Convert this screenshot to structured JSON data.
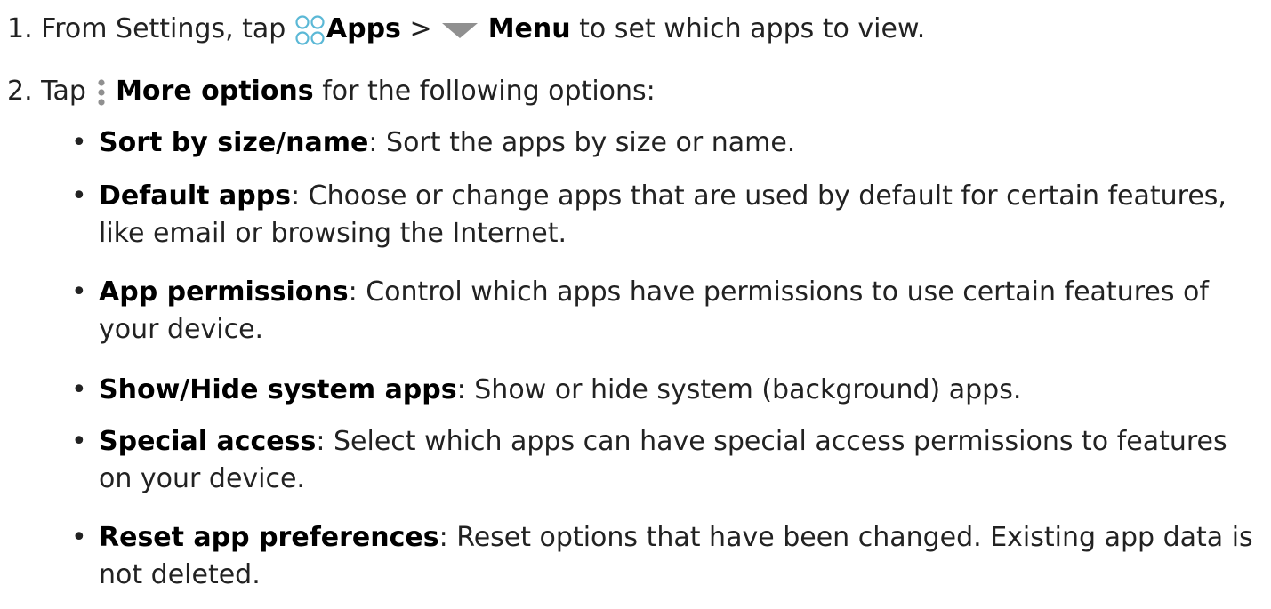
{
  "steps": [
    {
      "number": "1.",
      "text_before": "From Settings, tap",
      "apps_label": "Apps",
      "separator": ">",
      "menu_label": "Menu",
      "text_after": "to set which apps to view."
    },
    {
      "number": "2.",
      "text_before": "Tap",
      "more_label": "More options",
      "text_after": "for the following options:"
    }
  ],
  "options": [
    {
      "term": "Sort by size/name",
      "description": ": Sort the apps by size or name."
    },
    {
      "term": "Default apps",
      "description": ": Choose or change apps that are used by default for certain features, like email or browsing the Internet."
    },
    {
      "term": "App permissions",
      "description": ": Control which apps have permissions to use certain features of your device."
    },
    {
      "term": "Show/Hide system apps",
      "description": ": Show or hide system (background) apps."
    },
    {
      "term": "Special access",
      "description": ": Select which apps can have special access permissions to features on your device."
    },
    {
      "term": "Reset app preferences",
      "description": ": Reset options that have been changed. Existing app data is not deleted."
    }
  ],
  "bullet_glyph": "•",
  "icons": {
    "apps": "apps-grid-icon",
    "menu": "menu-dropdown-triangle-icon",
    "more": "more-options-vertical-dots-icon"
  },
  "colors": {
    "text": "#222222",
    "term": "#000000",
    "apps_icon": "#5bb8d6",
    "icon_gray": "#909090"
  }
}
